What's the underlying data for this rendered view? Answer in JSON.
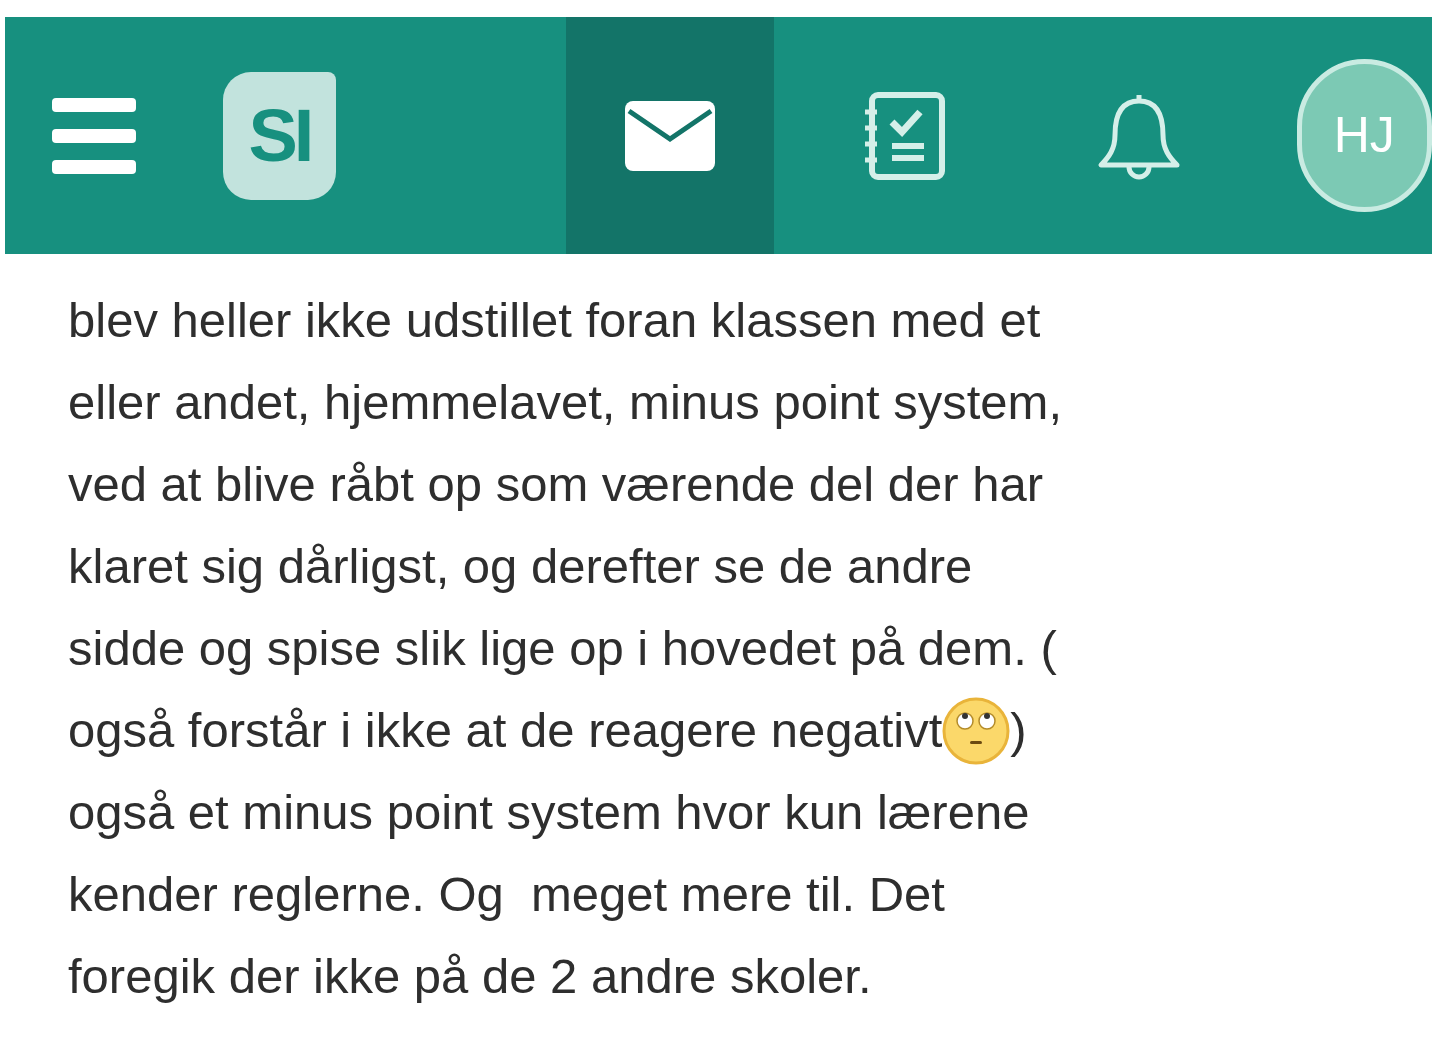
{
  "header": {
    "logo": "SI",
    "nav": [
      {
        "kind": "mail",
        "selected": true
      },
      {
        "kind": "checklist",
        "selected": false
      },
      {
        "kind": "bell",
        "selected": false
      }
    ],
    "avatar": "HJ"
  },
  "message": {
    "lines": [
      {
        "segments": [
          {
            "kind": "text",
            "text": "blev heller ikke udstillet foran klassen med et"
          }
        ]
      },
      {
        "segments": [
          {
            "kind": "text",
            "text": "eller andet, hjemmelavet, minus point system,"
          }
        ]
      },
      {
        "segments": [
          {
            "kind": "text",
            "text": "ved at blive råbt op som værende del der har"
          }
        ]
      },
      {
        "segments": [
          {
            "kind": "text",
            "text": "klaret sig dårligst, og derefter se de andre"
          }
        ]
      },
      {
        "segments": [
          {
            "kind": "text",
            "text": "sidde og spise slik lige op i hovedet på dem. ("
          }
        ]
      },
      {
        "segments": [
          {
            "kind": "text",
            "text": "også forstår i ikke at de reagere negativt"
          },
          {
            "kind": "emoji"
          },
          {
            "kind": "text",
            "text": ")"
          }
        ]
      },
      {
        "segments": [
          {
            "kind": "text",
            "text": "også et minus point system hvor kun lærene"
          }
        ]
      },
      {
        "segments": [
          {
            "kind": "text",
            "text": "kender reglerne. Og  meget mere til. Det"
          }
        ]
      },
      {
        "segments": [
          {
            "kind": "text",
            "text": "foregik der ikke på de 2 andre skoler."
          }
        ]
      }
    ]
  }
}
